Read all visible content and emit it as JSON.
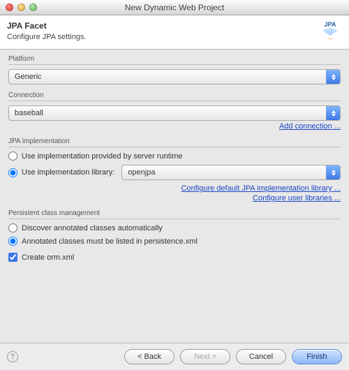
{
  "window": {
    "title": "New Dynamic Web Project"
  },
  "header": {
    "title": "JPA Facet",
    "subtitle": "Configure JPA settings.",
    "logo_text": "JPA"
  },
  "platform": {
    "label": "Platform",
    "value": "Generic"
  },
  "connection": {
    "label": "Connection",
    "value": "baseball",
    "add_link": "Add connection ..."
  },
  "implementation": {
    "label": "JPA implementation",
    "opt_server": "Use implementation provided by server runtime",
    "opt_library": "Use implementation library:",
    "library_value": "openjpa",
    "configure_default": "Configure default JPA implementation library ...",
    "configure_user": "Configure user libraries ..."
  },
  "pcm": {
    "label": "Persistent class management",
    "opt_discover": "Discover annotated classes automatically",
    "opt_listed": "Annotated classes must be listed in persistence.xml"
  },
  "create_orm": {
    "label": "Create orm.xml"
  },
  "buttons": {
    "back": "< Back",
    "next": "Next >",
    "cancel": "Cancel",
    "finish": "Finish"
  }
}
